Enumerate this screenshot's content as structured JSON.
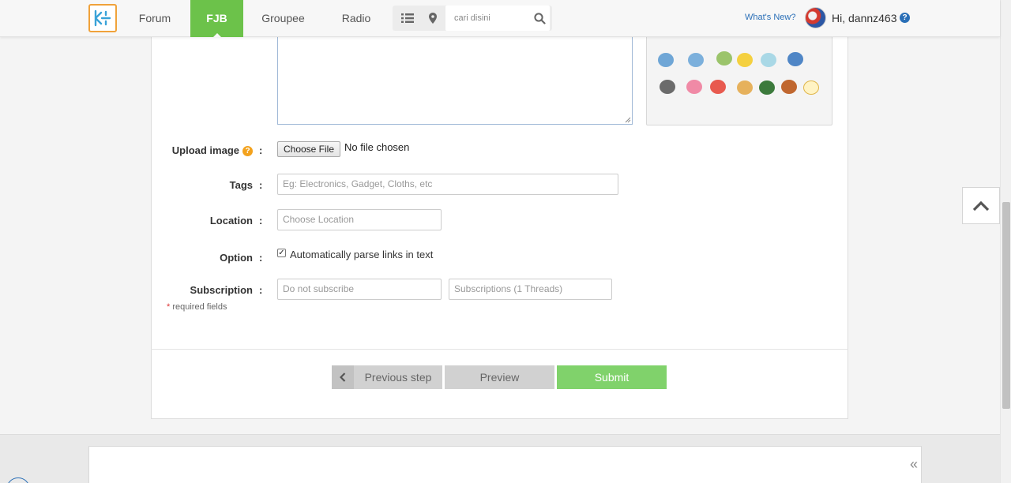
{
  "nav": {
    "items": [
      {
        "label": "Forum",
        "active": false
      },
      {
        "label": "FJB",
        "active": true
      },
      {
        "label": "Groupee",
        "active": false
      },
      {
        "label": "Radio",
        "active": false
      }
    ],
    "search_placeholder": "cari disini",
    "whats_new": "What's New?",
    "greeting": "Hi, dannz463",
    "help_glyph": "?"
  },
  "form": {
    "upload_label": "Upload image",
    "upload_help_glyph": "?",
    "file_button": "Choose File",
    "file_status": "No file chosen",
    "tags_label": "Tags",
    "tags_placeholder": "Eg: Electronics, Gadget, Cloths, etc",
    "location_label": "Location",
    "location_placeholder": "Choose Location",
    "option_label": "Option",
    "option_text": "Automatically parse links in text",
    "option_checked": true,
    "subscription_label": "Subscription",
    "subscription_value": "Do not subscribe",
    "subscriptions_value": "Subscriptions (1 Threads)",
    "colon": ":",
    "required_star": "*",
    "required_text": "required fields"
  },
  "buttons": {
    "previous": "Previous step",
    "preview": "Preview",
    "submit": "Submit"
  },
  "footer": {
    "collapse_glyph": "«"
  },
  "colors": {
    "accent_green": "#6cc24a",
    "submit_green": "#80d26b",
    "link_blue": "#2a6fb7",
    "logo_orange": "#f0a23a"
  },
  "icons": [
    "logo-icon",
    "list-icon",
    "location-pin-icon",
    "search-icon",
    "help-icon",
    "chevron-left-icon",
    "chevron-up-icon"
  ]
}
